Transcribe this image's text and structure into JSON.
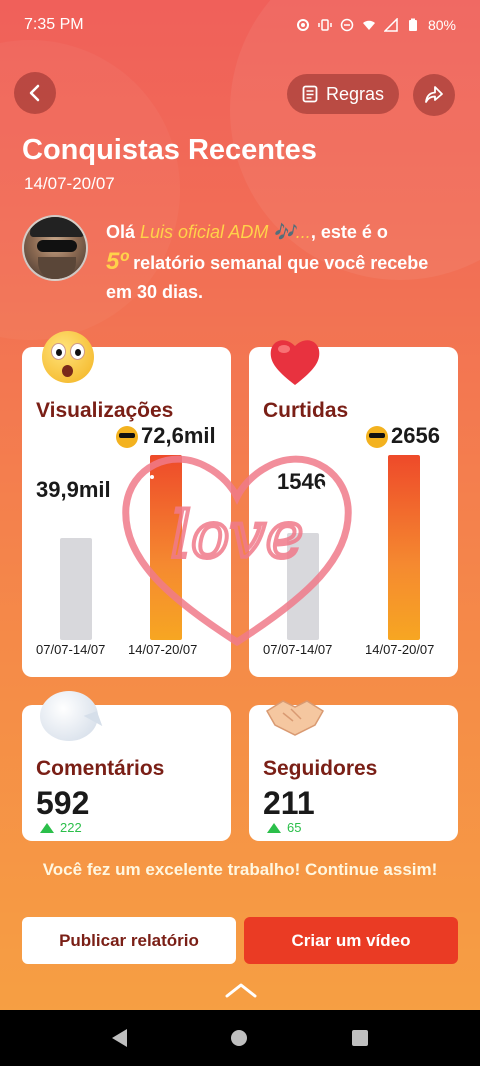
{
  "status_bar": {
    "time": "7:35 PM",
    "battery": "80%"
  },
  "header": {
    "rules_label": "Regras"
  },
  "title": "Conquistas Recentes",
  "date_range": "14/07-20/07",
  "intro": {
    "prefix": "Olá ",
    "username": "Luis oficial ADM 🎶...",
    "mid": ", este é o",
    "number": "5º",
    "suffix": " relatório semanal que você recebe em 30 dias."
  },
  "views": {
    "title": "Visualizações",
    "current_value": "72,6mil",
    "previous_value": "39,9mil",
    "previous_label": "07/07-14/07",
    "current_label": "14/07-20/07",
    "previous_fraction": 0.55,
    "current_fraction": 1.0
  },
  "likes": {
    "title": "Curtidas",
    "current_value": "2656",
    "previous_value": "1546",
    "previous_label": "07/07-14/07",
    "current_label": "14/07-20/07",
    "previous_fraction": 0.58,
    "current_fraction": 1.0
  },
  "comments": {
    "title": "Comentários",
    "value": "592",
    "delta": "222"
  },
  "followers": {
    "title": "Seguidores",
    "value": "211",
    "delta": "65"
  },
  "congrats": "Você fez um excelente trabalho! Continue assim!",
  "actions": {
    "publish_label": "Publicar relatório",
    "video_label": "Criar um vídeo"
  },
  "colors": {
    "accent": "#ea3b24",
    "card_title": "#7a1f16",
    "delta_green": "#2bbf4a"
  }
}
